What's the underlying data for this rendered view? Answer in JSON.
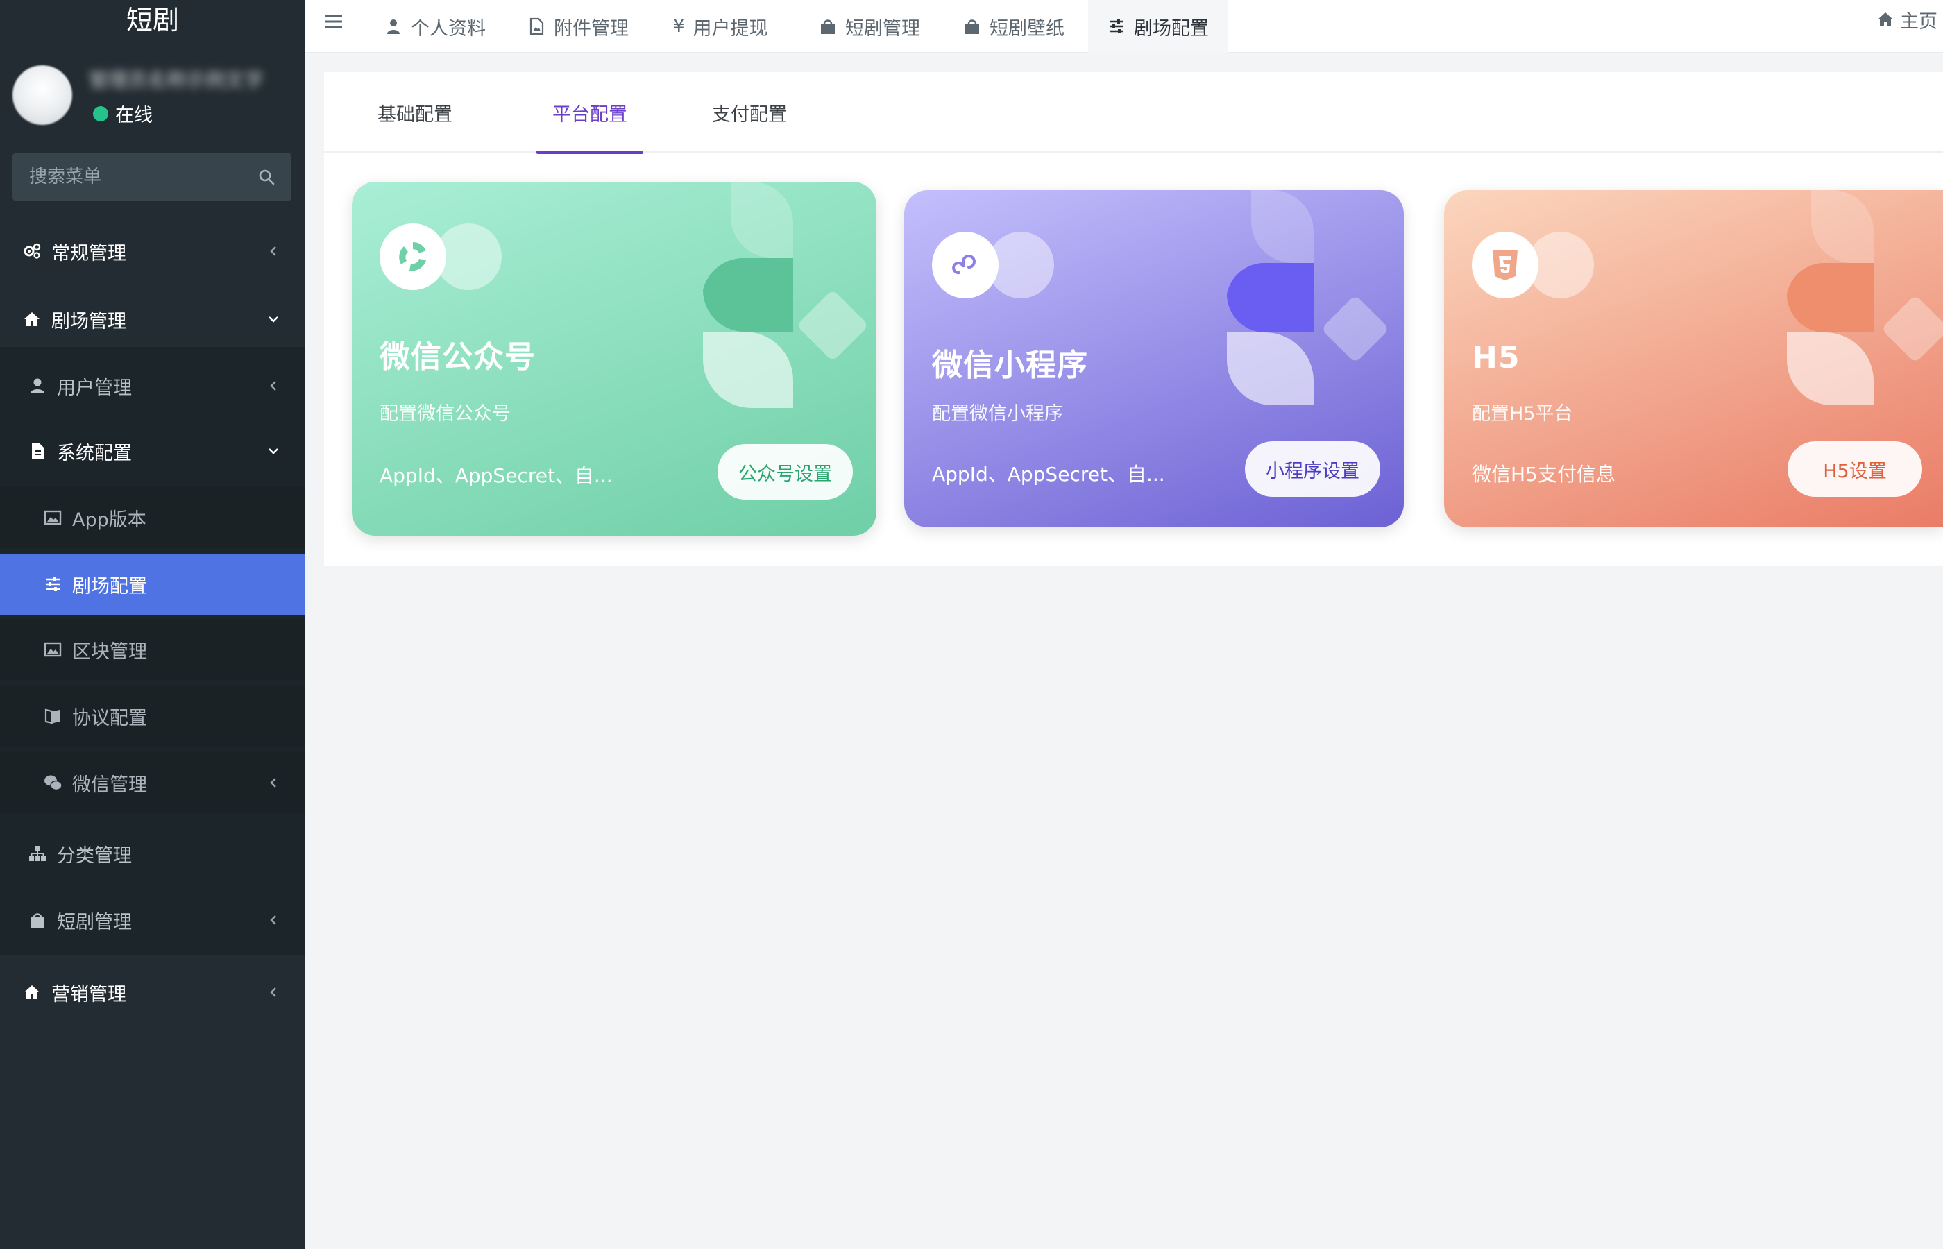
{
  "sidebar": {
    "brand": "短剧",
    "user": {
      "name": "管理员名称示例文字",
      "status": "在线"
    },
    "search": {
      "placeholder": "搜索菜单"
    },
    "menu": [
      {
        "label": "常规管理",
        "icon": "gears-icon",
        "level": 0,
        "arrow": "left"
      },
      {
        "label": "剧场管理",
        "icon": "home-icon",
        "level": 0,
        "arrow": "down"
      },
      {
        "label": "用户管理",
        "icon": "user-icon",
        "level": 1,
        "arrow": "left"
      },
      {
        "label": "系统配置",
        "icon": "file-icon",
        "level": 1,
        "arrow": "down"
      },
      {
        "label": "App版本",
        "icon": "image-icon",
        "level": 2
      },
      {
        "label": "剧场配置",
        "icon": "sliders-icon",
        "level": 2,
        "active": true
      },
      {
        "label": "区块管理",
        "icon": "image-icon",
        "level": 2
      },
      {
        "label": "协议配置",
        "icon": "book-icon",
        "level": 2
      },
      {
        "label": "微信管理",
        "icon": "wechat-icon",
        "level": 2,
        "arrow": "left"
      },
      {
        "label": "分类管理",
        "icon": "sitemap-icon",
        "level": 1
      },
      {
        "label": "短剧管理",
        "icon": "bag-icon",
        "level": 1,
        "arrow": "left"
      },
      {
        "label": "营销管理",
        "icon": "home-icon",
        "level": 0,
        "arrow": "left"
      }
    ]
  },
  "topnav": {
    "tabs": [
      {
        "label": "个人资料",
        "icon": "user-icon"
      },
      {
        "label": "附件管理",
        "icon": "file-image-icon"
      },
      {
        "label": "用户提现",
        "icon": "yen-icon"
      },
      {
        "label": "短剧管理",
        "icon": "bag-icon"
      },
      {
        "label": "短剧壁纸",
        "icon": "bag-icon"
      },
      {
        "label": "剧场配置",
        "icon": "sliders-icon",
        "active": true
      }
    ],
    "home": "主页"
  },
  "panel": {
    "tabs": [
      {
        "label": "基础配置"
      },
      {
        "label": "平台配置",
        "active": true
      },
      {
        "label": "支付配置"
      }
    ],
    "cards": [
      {
        "title": "微信公众号",
        "subtitle": "配置微信公众号",
        "description": "AppId、AppSecret、自...",
        "button": "公众号设置",
        "icon": "wechat-official-icon",
        "colors": {
          "from": "#a8ecd4",
          "to": "#5fc59c",
          "accent": "#5dc39a",
          "button_text": "#2aa570"
        }
      },
      {
        "title": "微信小程序",
        "subtitle": "配置微信小程序",
        "description": "AppId、AppSecret、自...",
        "button": "小程序设置",
        "icon": "mini-program-icon",
        "colors": {
          "from": "#c2bdfb",
          "to": "#6e63d6",
          "accent": "#6b5cf0",
          "button_text": "#4b3cc2"
        }
      },
      {
        "title": "H5",
        "subtitle": "配置H5平台",
        "description": "微信H5支付信息",
        "button": "H5设置",
        "icon": "html5-icon",
        "colors": {
          "from": "#fbd2b8",
          "to": "#ea7c66",
          "accent": "#ef8e6c",
          "button_text": "#e0603e"
        }
      }
    ]
  }
}
